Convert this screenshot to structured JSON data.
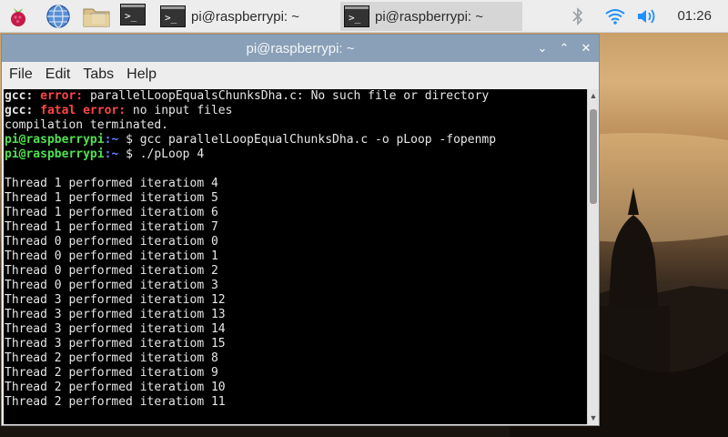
{
  "taskbar": {
    "tasks": [
      {
        "label": "pi@raspberrypi: ~"
      },
      {
        "label": "pi@raspberrypi: ~"
      }
    ],
    "clock": "01:26"
  },
  "window": {
    "title": "pi@raspberrypi: ~",
    "menu": [
      "File",
      "Edit",
      "Tabs",
      "Help"
    ]
  },
  "terminal": {
    "lines": [
      {
        "segments": [
          {
            "t": "gcc: ",
            "c": "bold"
          },
          {
            "t": "error: ",
            "c": "red"
          },
          {
            "t": "parallelLoopEqualsChunksDha.c: No such file or directory",
            "c": ""
          }
        ]
      },
      {
        "segments": [
          {
            "t": "gcc: ",
            "c": "bold"
          },
          {
            "t": "fatal error: ",
            "c": "red"
          },
          {
            "t": "no input files",
            "c": ""
          }
        ]
      },
      {
        "segments": [
          {
            "t": "compilation terminated.",
            "c": ""
          }
        ]
      },
      {
        "segments": [
          {
            "t": "pi@raspberrypi",
            "c": "green"
          },
          {
            "t": ":~ ",
            "c": "blue"
          },
          {
            "t": "$ gcc parallelLoopEqualChunksDha.c -o pLoop -fopenmp",
            "c": ""
          }
        ]
      },
      {
        "segments": [
          {
            "t": "pi@raspberrypi",
            "c": "green"
          },
          {
            "t": ":~ ",
            "c": "blue"
          },
          {
            "t": "$ ./pLoop 4",
            "c": ""
          }
        ]
      },
      {
        "segments": [
          {
            "t": "",
            "c": ""
          }
        ]
      },
      {
        "segments": [
          {
            "t": "Thread 1 performed iteratiom 4",
            "c": ""
          }
        ]
      },
      {
        "segments": [
          {
            "t": "Thread 1 performed iteratiom 5",
            "c": ""
          }
        ]
      },
      {
        "segments": [
          {
            "t": "Thread 1 performed iteratiom 6",
            "c": ""
          }
        ]
      },
      {
        "segments": [
          {
            "t": "Thread 1 performed iteratiom 7",
            "c": ""
          }
        ]
      },
      {
        "segments": [
          {
            "t": "Thread 0 performed iteratiom 0",
            "c": ""
          }
        ]
      },
      {
        "segments": [
          {
            "t": "Thread 0 performed iteratiom 1",
            "c": ""
          }
        ]
      },
      {
        "segments": [
          {
            "t": "Thread 0 performed iteratiom 2",
            "c": ""
          }
        ]
      },
      {
        "segments": [
          {
            "t": "Thread 0 performed iteratiom 3",
            "c": ""
          }
        ]
      },
      {
        "segments": [
          {
            "t": "Thread 3 performed iteratiom 12",
            "c": ""
          }
        ]
      },
      {
        "segments": [
          {
            "t": "Thread 3 performed iteratiom 13",
            "c": ""
          }
        ]
      },
      {
        "segments": [
          {
            "t": "Thread 3 performed iteratiom 14",
            "c": ""
          }
        ]
      },
      {
        "segments": [
          {
            "t": "Thread 3 performed iteratiom 15",
            "c": ""
          }
        ]
      },
      {
        "segments": [
          {
            "t": "Thread 2 performed iteratiom 8",
            "c": ""
          }
        ]
      },
      {
        "segments": [
          {
            "t": "Thread 2 performed iteratiom 9",
            "c": ""
          }
        ]
      },
      {
        "segments": [
          {
            "t": "Thread 2 performed iteratiom 10",
            "c": ""
          }
        ]
      },
      {
        "segments": [
          {
            "t": "Thread 2 performed iteratiom 11",
            "c": ""
          }
        ]
      }
    ]
  },
  "icons": {
    "menu": "raspberry-icon",
    "browser": "globe-icon",
    "files": "folder-icon",
    "terminal": "terminal-icon",
    "bluetooth": "bluetooth-icon",
    "wifi": "wifi-icon",
    "volume": "volume-icon"
  },
  "colors": {
    "titlebar": "#8aa0b8",
    "terminal_bg": "#000000",
    "prompt_user": "#50e050",
    "prompt_path": "#6a7fff",
    "error": "#ff4545",
    "tray_icons": "#1e90ff"
  }
}
